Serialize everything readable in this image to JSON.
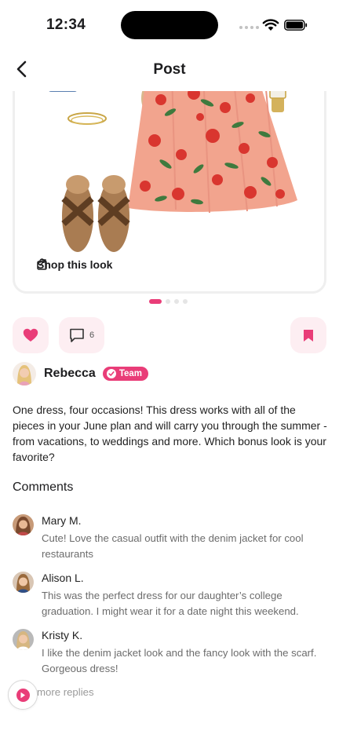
{
  "status_bar": {
    "time": "12:34"
  },
  "header": {
    "title": "Post",
    "back_icon": "chevron-left-icon"
  },
  "post": {
    "shop_label": "Shop this look",
    "carousel": {
      "total": 4,
      "active": 0
    },
    "comment_count": "6",
    "liked": true,
    "saved": true
  },
  "author": {
    "name": "Rebecca",
    "badge": "Team"
  },
  "caption": "One dress, four occasions! This dress works with all of the pieces in your June plan and will carry you through the summer - from vacations, to weddings and more. Which bonus look is your favorite?",
  "comments_title": "Comments",
  "comments": [
    {
      "name": "Mary M.",
      "text": "Cute!  Love the casual outfit with the denim jacket for cool restaurants"
    },
    {
      "name": "Alison L.",
      "text": "This was the perfect dress for our daughter’s college graduation. I might wear it for a date night this weekend."
    },
    {
      "name": "Kristy K.",
      "text": "I like the denim jacket look and the fancy look with the scarf.  Gorgeous dress!"
    }
  ],
  "more_replies": "more replies",
  "colors": {
    "accent": "#e93d78",
    "pill_bg": "#fdeef2",
    "muted_text": "#6c6c6c"
  }
}
